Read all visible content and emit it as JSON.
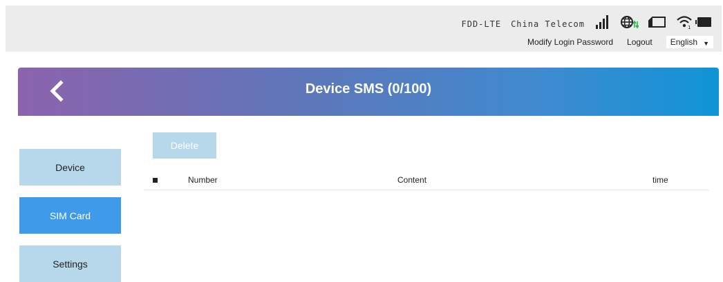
{
  "header": {
    "network_type": "FDD-LTE",
    "carrier": "China Telecom",
    "modify_password": "Modify Login Password",
    "logout": "Logout",
    "language": "English",
    "icons": [
      "signal-icon",
      "globe-data-icon",
      "sim-icon",
      "wifi-icon",
      "battery-icon"
    ]
  },
  "banner": {
    "title": "Device SMS (0/100)",
    "back_icon": "chevron-left-icon",
    "gradient_start": "#8c63ad",
    "gradient_end": "#0f94d6"
  },
  "sidebar": {
    "items": [
      {
        "label": "Device",
        "active": false
      },
      {
        "label": "SIM Card",
        "active": true
      },
      {
        "label": "Settings",
        "active": false
      }
    ]
  },
  "toolbar": {
    "delete_label": "Delete"
  },
  "table": {
    "columns": [
      "Number",
      "Content",
      "time"
    ],
    "rows": []
  },
  "colors": {
    "active_accent": "#3f9ae9",
    "inactive_button": "#b7d7ea"
  }
}
